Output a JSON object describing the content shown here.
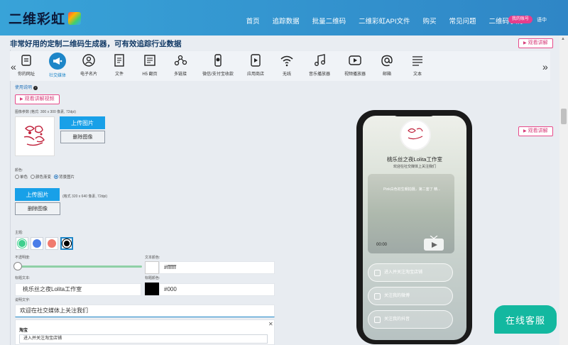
{
  "header": {
    "logo": "二维彩虹",
    "nav": [
      "首页",
      "追踪数据",
      "批量二维码",
      "二维彩虹API文件",
      "购买",
      "常见问题",
      "二维码学院"
    ],
    "account": "我的账号",
    "lang": "语中"
  },
  "subtitle": "非常好用的定制二维码生成器，可有效追踪行业数据",
  "watch_label": "观看讲解",
  "tools": [
    {
      "label": "你的网址",
      "icon": "link-icon"
    },
    {
      "label": "社交媒体",
      "icon": "megaphone-icon"
    },
    {
      "label": "电子名片",
      "icon": "contact-card-icon"
    },
    {
      "label": "文件",
      "icon": "file-icon"
    },
    {
      "label": "H5 翻页",
      "icon": "h5-page-icon"
    },
    {
      "label": "多链接",
      "icon": "multi-link-icon"
    },
    {
      "label": "微信/支付宝收款",
      "icon": "payment-icon"
    },
    {
      "label": "应用商店",
      "icon": "app-store-icon"
    },
    {
      "label": "无线",
      "icon": "wifi-icon"
    },
    {
      "label": "音乐播放器",
      "icon": "music-icon"
    },
    {
      "label": "视频播放器",
      "icon": "video-icon"
    },
    {
      "label": "邮箱",
      "icon": "email-icon"
    },
    {
      "label": "文本",
      "icon": "text-icon"
    }
  ],
  "form": {
    "usage": "使用说明",
    "watch_video": "观看讲解视频",
    "logo_size": "图像参数 (格式: 300 x 300 像素, 72dpi)",
    "upload": "上传图片",
    "delete": "删除图像",
    "bg_label": "颜色:",
    "bg_options": [
      "单色",
      "颜色渐变",
      "背景图片"
    ],
    "bg_size": "(格式 320 x 640 像素, 72dpi)",
    "theme_label": "主题:",
    "opacity_label": "不透明度:",
    "text_color_label": "文本颜色:",
    "text_color": "#ffffff",
    "title_label": "标题文本:",
    "title_value": "桃乐丝之夜Lolita工作室",
    "title_color_label": "标题颜色:",
    "title_color": "#000",
    "desc_label": "说明文字:",
    "desc_value": "欢迎在社交媒体上关注我们",
    "card_title": "淘宝",
    "card_placeholder": "进入并关注淘宝店铺"
  },
  "phone": {
    "title": "桃乐丝之夜Lolita工作室",
    "desc": "欢迎在社交媒体上关注我们",
    "video_caption": "Pink白色初生朝拍摄，第二套了 精...",
    "time": "00:00",
    "rows": [
      "进入并关注淘宝店铺",
      "关注我的微博",
      "关注我的抖音"
    ]
  },
  "chat": "在线客服",
  "colors": {
    "header_from": "#38a3d8",
    "header_to": "#2f86c6",
    "accent": "#18a0e8",
    "pink": "#e74a8a",
    "chat": "#13b8a0",
    "theme_colors": [
      "#3ecf8e",
      "#4a7de8",
      "#f07a6e",
      "#000000"
    ]
  }
}
